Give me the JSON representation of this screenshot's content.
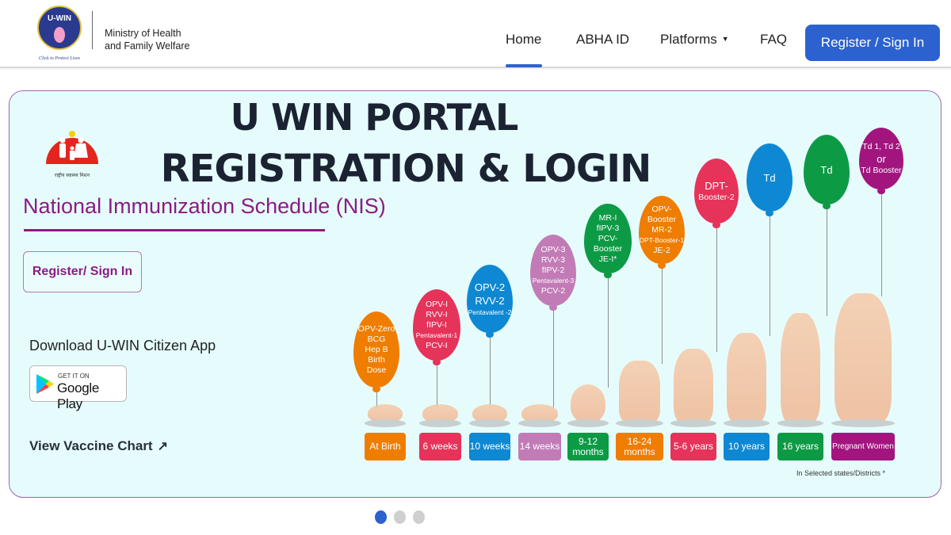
{
  "header": {
    "logo_text": "U-WIN",
    "logo_tagline": "Click to Protect Lives",
    "ministry_line1": "Ministry of Health",
    "ministry_line2": "and Family Welfare",
    "nav": [
      {
        "label": "Home",
        "active": true
      },
      {
        "label": "ABHA ID",
        "active": false
      },
      {
        "label": "Platforms",
        "active": false,
        "dropdown": true
      },
      {
        "label": "FAQ",
        "active": false
      }
    ],
    "register_button": "Register / Sign In",
    "accent_color": "#2c62cf"
  },
  "banner": {
    "nhm_logo_text": "NATIONAL HEALTH MISSION",
    "title_line1": "U WIN PORTAL",
    "title_line2": "REGISTRATION & LOGIN",
    "subtitle": "National Immunization Schedule (NIS)",
    "register_button": "Register/ Sign In",
    "download_text": "Download U-WIN Citizen App",
    "google_play_small": "GET IT ON",
    "google_play_big": "Google Play",
    "view_chart": "View Vaccine Chart",
    "view_chart_icon": "arrow-up-right-icon",
    "footnote": "In Selected states/Districts   *",
    "schedule": [
      {
        "age": "At Birth",
        "vaccines": [
          "OPV-Zero",
          "BCG",
          "Hep B",
          "Birth",
          "Dose"
        ],
        "color": "#ef7d00"
      },
      {
        "age": "6 weeks",
        "vaccines": [
          "OPV-I",
          "RVV-I",
          "fIPV-I",
          "Pentavalent-1",
          "PCV-I"
        ],
        "color": "#e6335a"
      },
      {
        "age": "10 weeks",
        "vaccines": [
          "OPV-2",
          "RVV-2",
          "Pentavalent -2"
        ],
        "color": "#0e88d3"
      },
      {
        "age": "14 weeks",
        "vaccines": [
          "OPV-3",
          "RVV-3",
          "fIPV-2",
          "Pentavalent-3",
          "PCV-2"
        ],
        "color": "#c27bb7"
      },
      {
        "age": "9-12 months",
        "vaccines": [
          "MR-I",
          "fIPV-3",
          "PCV-Booster",
          "JE-I*"
        ],
        "color": "#0d9a45"
      },
      {
        "age": "16-24 months",
        "vaccines": [
          "OPV-Booster",
          "MR-2",
          "DPT-Booster-1",
          "JE-2"
        ],
        "color": "#ef7d00"
      },
      {
        "age": "5-6 years",
        "vaccines": [
          "DPT-",
          "Booster-2"
        ],
        "color": "#e6335a"
      },
      {
        "age": "10 years",
        "vaccines": [
          "Td"
        ],
        "color": "#0e88d3"
      },
      {
        "age": "16 years",
        "vaccines": [
          "Td"
        ],
        "color": "#0d9a45"
      },
      {
        "age": "Pregnant Women",
        "vaccines": [
          "Td 1, Td 2",
          "or",
          "Td Booster"
        ],
        "color": "#a2157f"
      }
    ]
  },
  "carousel": {
    "slides": 3,
    "active_index": 0
  }
}
